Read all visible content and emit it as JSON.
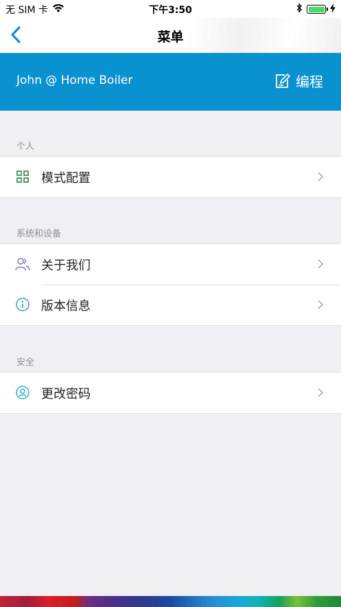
{
  "status_bar": {
    "carrier": "无 SIM 卡",
    "time": "下午3:50"
  },
  "nav": {
    "title": "菜单"
  },
  "banner": {
    "title": "John @ Home Boiler",
    "edit_label": "编程",
    "color": "#0a91cf"
  },
  "sections": [
    {
      "header": "个人",
      "items": [
        {
          "label": "模式配置",
          "icon": "grid-icon",
          "icon_color": "#2e7d4f"
        }
      ]
    },
    {
      "header": "系统和设备",
      "items": [
        {
          "label": "关于我们",
          "icon": "users-icon",
          "icon_color": "#8e6fb8"
        },
        {
          "label": "版本信息",
          "icon": "info-icon",
          "icon_color": "#2a9fd6"
        }
      ]
    },
    {
      "header": "安全",
      "items": [
        {
          "label": "更改密码",
          "icon": "user-circle-icon",
          "icon_color": "#2ab3c8"
        }
      ]
    }
  ]
}
